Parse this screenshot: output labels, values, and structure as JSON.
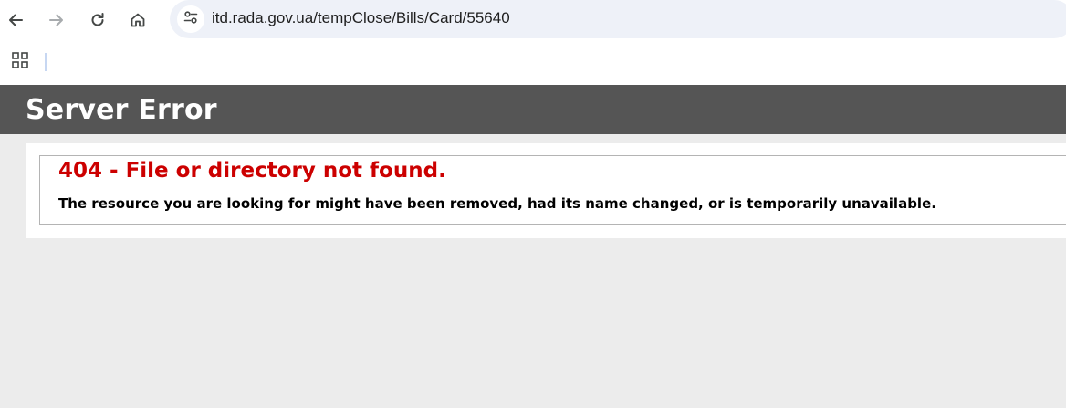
{
  "browser": {
    "url": "itd.rada.gov.ua/tempClose/Bills/Card/55640",
    "icons": {
      "back": "back-arrow-icon",
      "forward": "forward-arrow-icon",
      "reload": "reload-icon",
      "home": "home-icon",
      "site_info": "tune-icon",
      "apps": "apps-grid-icon"
    }
  },
  "page": {
    "header_title": "Server Error",
    "error_heading": "404 - File or directory not found.",
    "error_message": "The resource you are looking for might have been removed, had its name changed, or is temporarily unavailable."
  },
  "colors": {
    "header_bg": "#555555",
    "error_red": "#cc0000",
    "page_bg": "#ececec"
  }
}
